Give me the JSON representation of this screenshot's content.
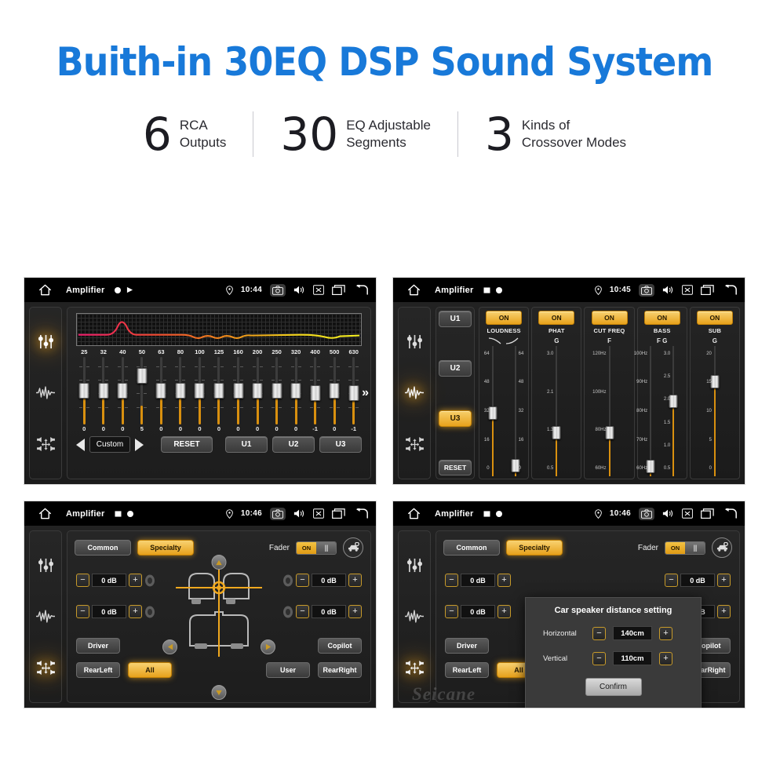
{
  "hero": {
    "title": "Buith-in 30EQ DSP Sound System",
    "stats": [
      {
        "number": "6",
        "text": "RCA\nOutputs"
      },
      {
        "number": "30",
        "text": "EQ Adjustable\nSegments"
      },
      {
        "number": "3",
        "text": "Kinds of\nCrossover Modes"
      }
    ]
  },
  "colors": {
    "brand_blue": "#1879d9",
    "amber": "#e8a21c",
    "amber_light": "#f8d272",
    "panel_bg": "#1d1d1d",
    "track_orange": "#d9900f"
  },
  "panel1": {
    "statusbar": {
      "title": "Amplifier",
      "time": "10:44",
      "icons": [
        "home-icon",
        "record-dot-icon",
        "play-icon",
        "location-pin-icon",
        "camera-icon",
        "volume-icon",
        "mute-icon",
        "recents-icon",
        "back-icon"
      ]
    },
    "rail": [
      {
        "name": "equalizer-icon",
        "active": true
      },
      {
        "name": "waveform-icon",
        "active": false
      },
      {
        "name": "balance-icon",
        "active": false
      }
    ],
    "eq": {
      "frequencies": [
        "25",
        "32",
        "40",
        "50",
        "63",
        "80",
        "100",
        "125",
        "160",
        "200",
        "250",
        "320",
        "400",
        "500",
        "630"
      ],
      "values": [
        "0",
        "0",
        "0",
        "5",
        "0",
        "0",
        "0",
        "0",
        "0",
        "0",
        "0",
        "0",
        "-1",
        "0",
        "-1"
      ],
      "slider_pct": [
        50,
        50,
        50,
        72,
        50,
        50,
        50,
        50,
        50,
        50,
        50,
        50,
        46,
        50,
        46
      ]
    },
    "controls": {
      "prev": "prev-arrow",
      "preset": "Custom",
      "next": "next-arrow",
      "reset": "RESET",
      "u1": "U1",
      "u2": "U2",
      "u3": "U3",
      "expand": "»"
    }
  },
  "panel2": {
    "statusbar": {
      "title": "Amplifier",
      "time": "10:45"
    },
    "rail": [
      {
        "name": "equalizer-icon",
        "active": false
      },
      {
        "name": "waveform-icon",
        "active": true
      },
      {
        "name": "balance-icon",
        "active": false
      }
    ],
    "presets": {
      "u1": "U1",
      "u2": "U2",
      "u3": "U3",
      "active": "U3",
      "reset": "RESET"
    },
    "effects": [
      {
        "label": "LOUDNESS",
        "state": "ON",
        "header": "curves",
        "sliders": [
          {
            "axis": "",
            "ticks": [
              "64",
              "48",
              "32",
              "16",
              "0"
            ],
            "value_pct": 48,
            "side": "left"
          },
          {
            "axis": "",
            "ticks": [
              "64",
              "48",
              "32",
              "16",
              "0"
            ],
            "value_pct": 8,
            "side": "right"
          }
        ]
      },
      {
        "label": "PHAT",
        "state": "ON",
        "header": "G",
        "sliders": [
          {
            "axis": "G",
            "ticks": [
              "3.0",
              "2.1",
              "1.3",
              "0.5"
            ],
            "value_pct": 33
          }
        ]
      },
      {
        "label": "CUT FREQ",
        "state": "ON",
        "header": "F",
        "sliders": [
          {
            "axis": "F",
            "ticks": [
              "120Hz",
              "100Hz",
              "80Hz",
              "60Hz"
            ],
            "value_pct": 33
          }
        ]
      },
      {
        "label": "BASS",
        "state": "ON",
        "header": "F G",
        "sliders": [
          {
            "axis": "F",
            "ticks": [
              "100Hz",
              "90Hz",
              "80Hz",
              "70Hz",
              "60Hz"
            ],
            "value_pct": 7
          },
          {
            "axis": "G",
            "ticks": [
              "3.0",
              "2.5",
              "2.0",
              "1.5",
              "1.0",
              "0.5"
            ],
            "value_pct": 57
          }
        ]
      },
      {
        "label": "SUB",
        "state": "ON",
        "header": "G",
        "sliders": [
          {
            "axis": "G",
            "ticks": [
              "20",
              "15",
              "10",
              "5",
              "0"
            ],
            "value_pct": 72
          }
        ]
      }
    ]
  },
  "panel3": {
    "statusbar": {
      "title": "Amplifier",
      "time": "10:46"
    },
    "rail": [
      {
        "name": "equalizer-icon",
        "active": false
      },
      {
        "name": "waveform-icon",
        "active": false
      },
      {
        "name": "balance-icon",
        "active": true
      }
    ],
    "tabs": {
      "common": "Common",
      "specialty": "Specialty",
      "active": "Specialty"
    },
    "fader": {
      "label": "Fader",
      "state": "ON"
    },
    "car_icon": "car-settings-icon",
    "levels": [
      {
        "position": "front-left",
        "value": "0 dB"
      },
      {
        "position": "rear-left",
        "value": "0 dB"
      },
      {
        "position": "front-right",
        "value": "0 dB"
      },
      {
        "position": "rear-right",
        "value": "0 dB"
      }
    ],
    "seat_buttons": {
      "driver": "Driver",
      "copilot": "Copilot",
      "rear_left": "RearLeft",
      "all": "All",
      "user": "User",
      "rear_right": "RearRight",
      "active": "All"
    }
  },
  "panel4": {
    "statusbar": {
      "title": "Amplifier",
      "time": "10:46"
    },
    "dialog": {
      "title": "Car speaker distance setting",
      "rows": [
        {
          "label": "Horizontal",
          "value": "140cm"
        },
        {
          "label": "Vertical",
          "value": "110cm"
        }
      ],
      "confirm": "Confirm"
    },
    "watermark": "Seicane"
  }
}
